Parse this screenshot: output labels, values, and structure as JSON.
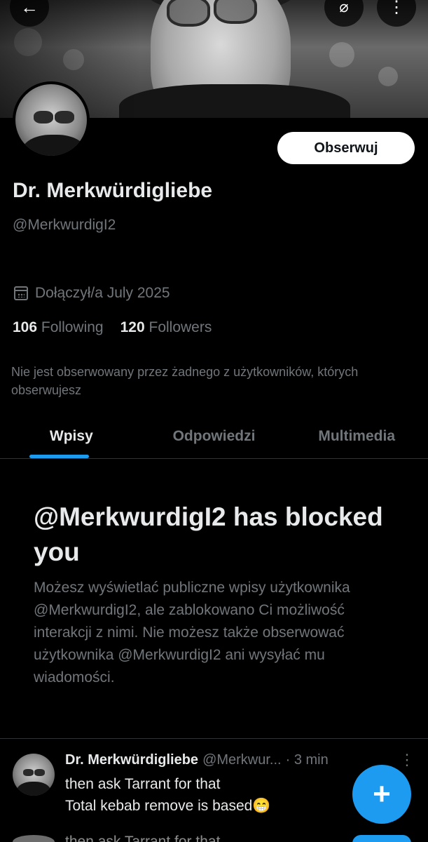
{
  "header": {
    "back_icon": "arrow-left-icon",
    "notify_icon": "bell-slash-icon",
    "more_icon": "more-vertical-icon"
  },
  "profile": {
    "display_name": "Dr. Merkwürdigliebe",
    "handle": "@MerkwurdigI2",
    "follow_label": "Obserwuj",
    "joined": "Dołączył/a July 2025",
    "following_count": "106",
    "following_label": "Following",
    "followers_count": "120",
    "followers_label": "Followers",
    "mutual_note": "Nie jest obserwowany przez żadnego z użytkowników, których obserwujesz"
  },
  "tabs": [
    {
      "label": "Wpisy",
      "active": true
    },
    {
      "label": "Odpowiedzi",
      "active": false
    },
    {
      "label": "Multimedia",
      "active": false
    }
  ],
  "blocked": {
    "title": "@MerkwurdigI2 has blocked you",
    "description": "Możesz wyświetlać publiczne wpisy użytkownika @MerkwurdigI2, ale zablokowano Ci możliwość interakcji z nimi. Nie możesz także obserwować użytkownika @MerkwurdigI2 ani wysyłać mu wiadomości."
  },
  "post": {
    "author": "Dr. Merkwürdigliebe",
    "handle": "@Merkwur...",
    "time": "· 3 min",
    "line1": "then ask Tarrant for that",
    "line2": "Total kebab remove is based😁",
    "next_line": "then ask Tarrant for that"
  },
  "fab": {
    "label": "+"
  },
  "colors": {
    "accent": "#1d9bf0",
    "muted": "#71767b",
    "text": "#e7e9ea",
    "background": "#000000"
  }
}
